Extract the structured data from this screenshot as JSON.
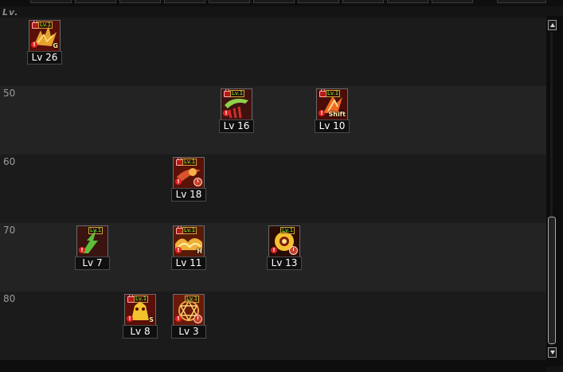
{
  "header": {
    "level_column_label": "Lv."
  },
  "rows": [
    {
      "label": ""
    },
    {
      "label": "50"
    },
    {
      "label": "60"
    },
    {
      "label": "70"
    },
    {
      "label": "80"
    }
  ],
  "skills": [
    {
      "level_label": "Lv 26",
      "key": "G",
      "icon": "spiked-claw-icon",
      "accent": "#e7a12d"
    },
    {
      "level_label": "Lv 16",
      "key": "",
      "icon": "green-claw-icon",
      "accent": "#8fd14a"
    },
    {
      "level_label": "Lv 10",
      "key": "Shift",
      "icon": "fire-slash-icon",
      "accent": "#f06a22"
    },
    {
      "level_label": "Lv 18",
      "key": "",
      "icon": "fire-dash-icon",
      "accent": "#d9542c"
    },
    {
      "level_label": "Lv 7",
      "key": "",
      "icon": "green-lightning-icon",
      "accent": "#5fbf3a"
    },
    {
      "level_label": "Lv 11",
      "key": "H",
      "icon": "flame-wave-icon",
      "accent": "#f0b03a"
    },
    {
      "level_label": "Lv 13",
      "key": "",
      "icon": "sun-burst-icon",
      "accent": "#f5c030"
    },
    {
      "level_label": "Lv 8",
      "key": "S",
      "icon": "golden-beast-icon",
      "accent": "#f2c22e"
    },
    {
      "level_label": "Lv 3",
      "key": "",
      "icon": "magic-circle-icon",
      "accent": "#e24a1e"
    }
  ],
  "scrollbar": {
    "position": 0.85
  }
}
